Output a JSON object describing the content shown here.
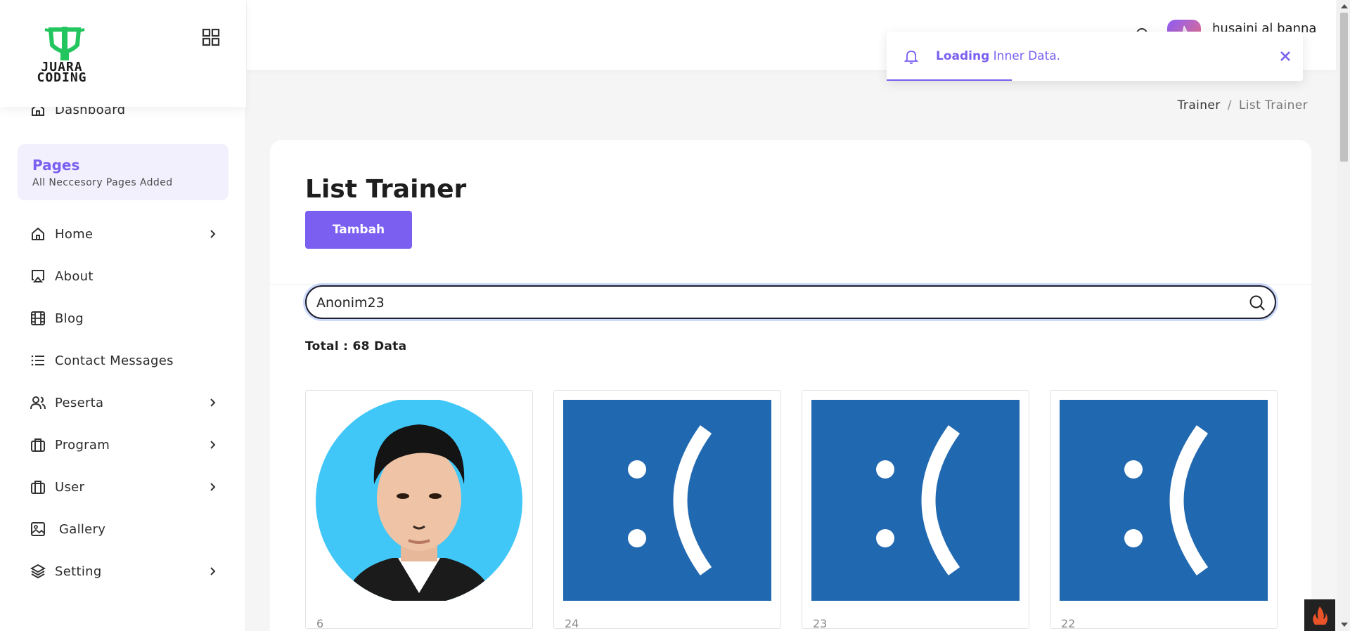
{
  "brand": {
    "name_line1": "JUARA",
    "name_line2": "CODING"
  },
  "sidebar": {
    "dashboard": "Dashboard",
    "pages_title": "Pages",
    "pages_subtitle": "All Neccesory Pages Added",
    "items": [
      {
        "label": "Home",
        "icon": "home-icon",
        "has_submenu": true
      },
      {
        "label": "About",
        "icon": "airplay-icon",
        "has_submenu": false
      },
      {
        "label": "Blog",
        "icon": "film-icon",
        "has_submenu": false
      },
      {
        "label": "Contact Messages",
        "icon": "list-icon",
        "has_submenu": false
      },
      {
        "label": "Peserta",
        "icon": "users-icon",
        "has_submenu": true
      },
      {
        "label": "Program",
        "icon": "briefcase-icon",
        "has_submenu": true
      },
      {
        "label": "User",
        "icon": "briefcase-icon",
        "has_submenu": true
      },
      {
        "label": "Gallery",
        "icon": "image-icon",
        "has_submenu": false
      },
      {
        "label": "Setting",
        "icon": "layers-icon",
        "has_submenu": true
      }
    ]
  },
  "topbar": {
    "user_name": "husaini al banna"
  },
  "toast": {
    "bold": "Loading",
    "text": " Inner Data.",
    "progress": 0.3
  },
  "breadcrumb": {
    "parent": "Trainer",
    "separator": "/",
    "current": "List Trainer"
  },
  "main": {
    "title": "List Trainer",
    "add_button": "Tambah",
    "search_value": "Anonim23",
    "total": "Total : 68 Data",
    "trainers": [
      {
        "id": "6",
        "photo": "portrait"
      },
      {
        "id": "24",
        "photo": "sad-face"
      },
      {
        "id": "23",
        "photo": "sad-face"
      },
      {
        "id": "22",
        "photo": "sad-face"
      }
    ]
  },
  "colors": {
    "accent": "#7a5ff0",
    "brand_green": "#22c55e",
    "sad_blue": "#2068b0",
    "portrait_bg": "#41c7f7"
  }
}
